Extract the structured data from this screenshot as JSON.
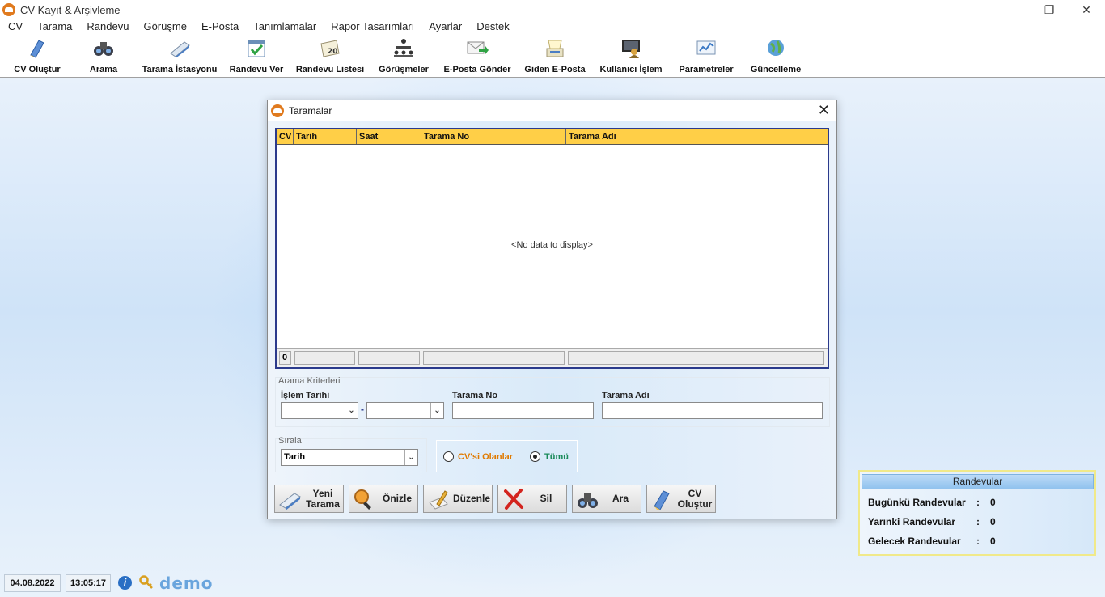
{
  "window": {
    "title": "CV Kayıt & Arşivleme",
    "controls": [
      "—",
      "❐",
      "✕"
    ]
  },
  "menu": [
    "CV",
    "Tarama",
    "Randevu",
    "Görüşme",
    "E-Posta",
    "Tanımlamalar",
    "Rapor Tasarımları",
    "Ayarlar",
    "Destek"
  ],
  "toolbar": [
    {
      "label": "CV Oluştur",
      "icon": "pen-document-icon"
    },
    {
      "label": "Arama",
      "icon": "binoculars-icon"
    },
    {
      "label": "Tarama İstasyonu",
      "icon": "scanner-icon"
    },
    {
      "label": "Randevu Ver",
      "icon": "calendar-check-icon"
    },
    {
      "label": "Randevu Listesi",
      "icon": "calendar-icon"
    },
    {
      "label": "Görüşmeler",
      "icon": "meeting-icon"
    },
    {
      "label": "E-Posta Gönder",
      "icon": "email-send-icon"
    },
    {
      "label": "Giden E-Posta",
      "icon": "outbox-icon"
    },
    {
      "label": "Kullanıcı İşlem",
      "icon": "user-monitor-icon"
    },
    {
      "label": "Parametreler",
      "icon": "parameters-icon"
    },
    {
      "label": "Güncelleme",
      "icon": "globe-update-icon"
    }
  ],
  "dialog": {
    "title": "Taramalar",
    "grid": {
      "columns": [
        "CV",
        "Tarih",
        "Saat",
        "Tarama No",
        "Tarama Adı"
      ],
      "empty_text": "<No data to display>",
      "footer_count": "0"
    },
    "search": {
      "group_label": "Arama Kriterleri",
      "islem_tarihi_label": "İşlem Tarihi",
      "range_separator": "-",
      "tarama_no_label": "Tarama No",
      "tarama_adi_label": "Tarama Adı"
    },
    "sort": {
      "group_label": "Sırala",
      "value": "Tarih"
    },
    "filter": {
      "options": [
        {
          "label": "CV'si Olanlar",
          "checked": false,
          "color": "#e07a00"
        },
        {
          "label": "Tümü",
          "checked": true,
          "color": "#1a8a5a"
        }
      ]
    },
    "actions": [
      {
        "label": "Yeni Tarama",
        "icon": "scanner-icon"
      },
      {
        "label": "Önizle",
        "icon": "magnifier-icon"
      },
      {
        "label": "Düzenle",
        "icon": "edit-pen-icon"
      },
      {
        "label": "Sil",
        "icon": "delete-x-icon"
      },
      {
        "label": "Ara",
        "icon": "binoculars-icon"
      },
      {
        "label": "CV Oluştur",
        "icon": "pen-document-icon"
      }
    ]
  },
  "randevular": {
    "title": "Randevular",
    "rows": [
      {
        "label": "Bugünkü Randevular",
        "sep": ":",
        "value": "0"
      },
      {
        "label": "Yarınki Randevular",
        "sep": ":",
        "value": "0"
      },
      {
        "label": "Gelecek Randevular",
        "sep": ":",
        "value": "0"
      }
    ]
  },
  "status": {
    "date": "04.08.2022",
    "time": "13:05:17",
    "info_glyph": "i",
    "demo_text": "demo"
  }
}
